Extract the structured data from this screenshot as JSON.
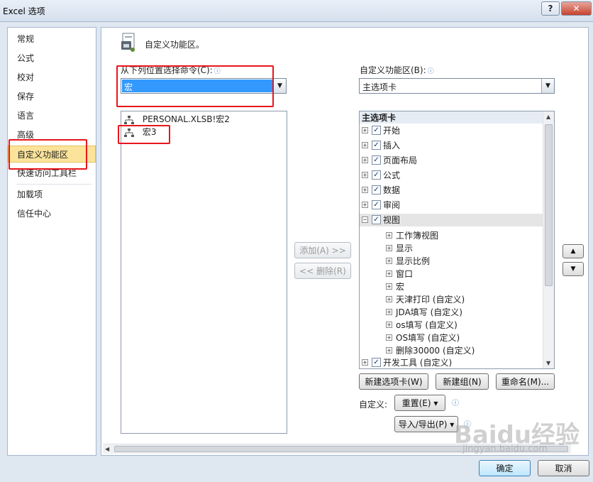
{
  "window": {
    "title": "Excel 选项"
  },
  "nav": {
    "items": [
      {
        "label": "常规"
      },
      {
        "label": "公式"
      },
      {
        "label": "校对"
      },
      {
        "label": "保存"
      },
      {
        "label": "语言"
      },
      {
        "label": "高级"
      },
      {
        "label": "自定义功能区"
      },
      {
        "label": "快速访问工具栏"
      },
      {
        "label": "加载项"
      },
      {
        "label": "信任中心"
      }
    ],
    "selected": "自定义功能区"
  },
  "main": {
    "title": "自定义功能区。",
    "choose_from": {
      "label": "从下列位置选择命令(C):",
      "value": "宏",
      "items": [
        {
          "label": "PERSONAL.XLSB!宏2",
          "icon": "macro-icon"
        },
        {
          "label": "宏3",
          "icon": "macro-icon"
        }
      ]
    },
    "customize_ribbon": {
      "label": "自定义功能区(B):",
      "value": "主选项卡",
      "tree_header": "主选项卡",
      "tabs": [
        {
          "label": "开始",
          "checked": true,
          "expanded": false
        },
        {
          "label": "插入",
          "checked": true,
          "expanded": false
        },
        {
          "label": "页面布局",
          "checked": true,
          "expanded": false
        },
        {
          "label": "公式",
          "checked": true,
          "expanded": false
        },
        {
          "label": "数据",
          "checked": true,
          "expanded": false
        },
        {
          "label": "审阅",
          "checked": true,
          "expanded": false
        },
        {
          "label": "视图",
          "checked": true,
          "expanded": true
        }
      ],
      "view_groups": [
        {
          "label": "工作簿视图"
        },
        {
          "label": "显示"
        },
        {
          "label": "显示比例"
        },
        {
          "label": "窗口"
        },
        {
          "label": "宏"
        },
        {
          "label": "天津打印 (自定义)"
        },
        {
          "label": "JDA填写 (自定义)"
        },
        {
          "label": "os填写 (自定义)"
        },
        {
          "label": "OS填写 (自定义)"
        },
        {
          "label": "删除30000 (自定义)"
        }
      ],
      "last_tab": {
        "label": "开发工具 (自定义)",
        "checked": true
      }
    },
    "buttons": {
      "add": "添加(A) >>",
      "remove": "<< 删除(R)",
      "new_tab": "新建选项卡(W)",
      "new_group": "新建组(N)",
      "rename": "重命名(M)...",
      "customize_label": "自定义:",
      "reset": "重置(E) ▾",
      "import_export": "导入/导出(P) ▾",
      "ok": "确定",
      "cancel": "取消"
    }
  },
  "watermark": {
    "text": "Baidu经验",
    "sub": "jingyan.baidu.com"
  },
  "colors": {
    "selection": "#3399ff",
    "nav_selected": "#fbe39a",
    "highlight_box": "#e8161c"
  }
}
